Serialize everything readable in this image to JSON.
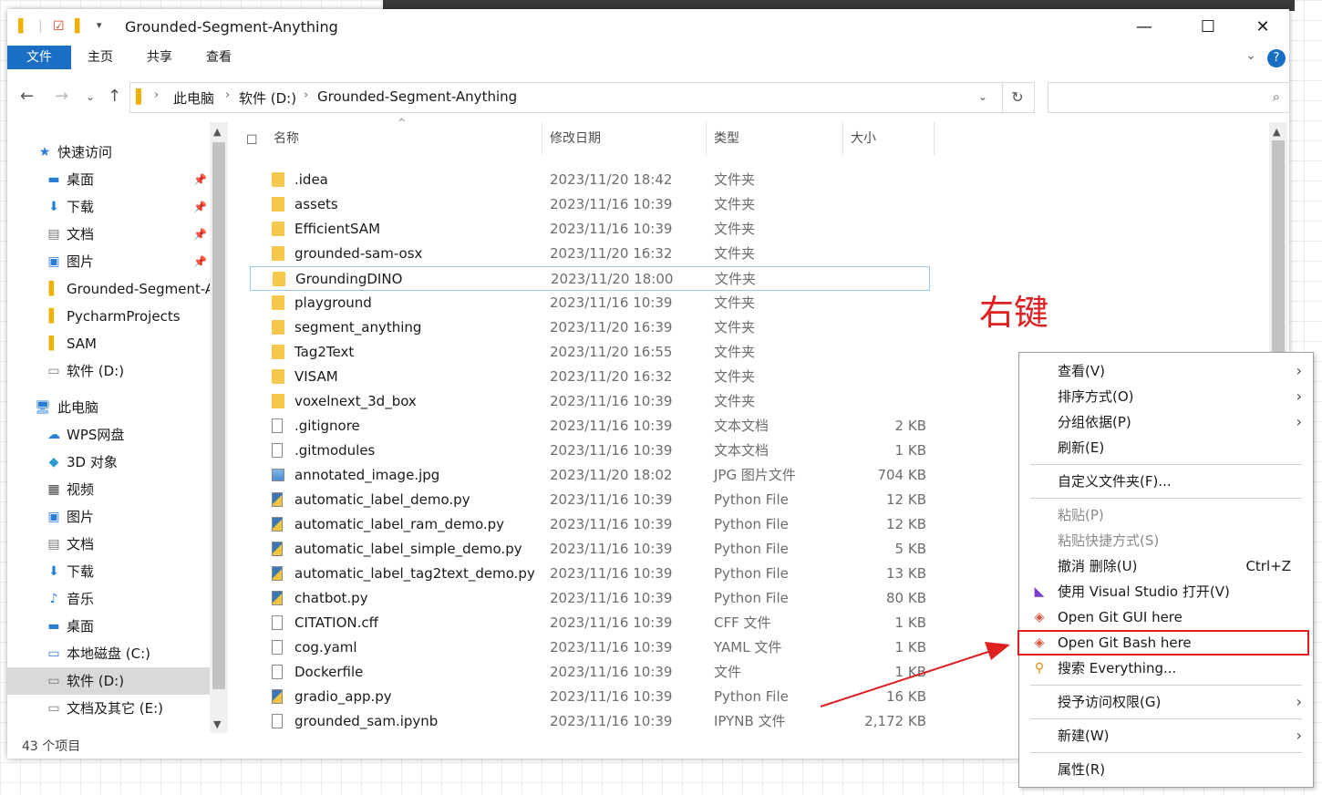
{
  "window": {
    "title": "Grounded-Segment-Anything",
    "controls": {
      "minimize": "—",
      "maximize": "☐",
      "close": "✕"
    }
  },
  "ribbon": {
    "tabs": [
      "文件",
      "主页",
      "共享",
      "查看"
    ],
    "help": "?"
  },
  "address": {
    "crumbs": [
      "此电脑",
      "软件 (D:)",
      "Grounded-Segment-Anything"
    ],
    "search_placeholder": ""
  },
  "nav": {
    "quick_access": "快速访问",
    "items": [
      {
        "label": "桌面",
        "icon": "desktop-icon",
        "pinned": true
      },
      {
        "label": "下载",
        "icon": "download-icon",
        "pinned": true
      },
      {
        "label": "文档",
        "icon": "document-icon",
        "pinned": true
      },
      {
        "label": "图片",
        "icon": "picture-icon",
        "pinned": true
      },
      {
        "label": "Grounded-Segment-Anything",
        "icon": "folder-icon",
        "pinned": false
      },
      {
        "label": "PycharmProjects",
        "icon": "folder-icon",
        "pinned": false
      },
      {
        "label": "SAM",
        "icon": "folder-icon",
        "pinned": false
      },
      {
        "label": "软件 (D:)",
        "icon": "drive-icon",
        "pinned": false
      }
    ],
    "this_pc": "此电脑",
    "pc_items": [
      {
        "label": "WPS网盘",
        "icon": "cloud-icon"
      },
      {
        "label": "3D 对象",
        "icon": "cube-icon"
      },
      {
        "label": "视频",
        "icon": "video-icon"
      },
      {
        "label": "图片",
        "icon": "picture-icon"
      },
      {
        "label": "文档",
        "icon": "document-icon"
      },
      {
        "label": "下载",
        "icon": "download-icon"
      },
      {
        "label": "音乐",
        "icon": "music-icon"
      },
      {
        "label": "桌面",
        "icon": "desktop-icon"
      },
      {
        "label": "本地磁盘 (C:)",
        "icon": "drive-icon"
      },
      {
        "label": "软件 (D:)",
        "icon": "drive-icon"
      },
      {
        "label": "文档及其它 (E:)",
        "icon": "drive-icon"
      }
    ],
    "selected": "软件 (D:)"
  },
  "list": {
    "columns": [
      "名称",
      "修改日期",
      "类型",
      "大小"
    ],
    "rows": [
      {
        "name": ".idea",
        "date": "2023/11/20 18:42",
        "type": "文件夹",
        "size": "",
        "kind": "folder"
      },
      {
        "name": "assets",
        "date": "2023/11/16 10:39",
        "type": "文件夹",
        "size": "",
        "kind": "folder"
      },
      {
        "name": "EfficientSAM",
        "date": "2023/11/16 10:39",
        "type": "文件夹",
        "size": "",
        "kind": "folder"
      },
      {
        "name": "grounded-sam-osx",
        "date": "2023/11/20 16:32",
        "type": "文件夹",
        "size": "",
        "kind": "folder"
      },
      {
        "name": "GroundingDINO",
        "date": "2023/11/20 18:00",
        "type": "文件夹",
        "size": "",
        "kind": "folder"
      },
      {
        "name": "playground",
        "date": "2023/11/16 10:39",
        "type": "文件夹",
        "size": "",
        "kind": "folder"
      },
      {
        "name": "segment_anything",
        "date": "2023/11/20 16:39",
        "type": "文件夹",
        "size": "",
        "kind": "folder"
      },
      {
        "name": "Tag2Text",
        "date": "2023/11/20 16:55",
        "type": "文件夹",
        "size": "",
        "kind": "folder"
      },
      {
        "name": "VISAM",
        "date": "2023/11/20 16:32",
        "type": "文件夹",
        "size": "",
        "kind": "folder"
      },
      {
        "name": "voxelnext_3d_box",
        "date": "2023/11/16 10:39",
        "type": "文件夹",
        "size": "",
        "kind": "folder"
      },
      {
        "name": ".gitignore",
        "date": "2023/11/16 10:39",
        "type": "文本文档",
        "size": "2 KB",
        "kind": "doc"
      },
      {
        "name": ".gitmodules",
        "date": "2023/11/16 10:39",
        "type": "文本文档",
        "size": "1 KB",
        "kind": "doc"
      },
      {
        "name": "annotated_image.jpg",
        "date": "2023/11/20 18:02",
        "type": "JPG 图片文件",
        "size": "704 KB",
        "kind": "jpg"
      },
      {
        "name": "automatic_label_demo.py",
        "date": "2023/11/16 10:39",
        "type": "Python File",
        "size": "12 KB",
        "kind": "py"
      },
      {
        "name": "automatic_label_ram_demo.py",
        "date": "2023/11/16 10:39",
        "type": "Python File",
        "size": "12 KB",
        "kind": "py"
      },
      {
        "name": "automatic_label_simple_demo.py",
        "date": "2023/11/16 10:39",
        "type": "Python File",
        "size": "5 KB",
        "kind": "py"
      },
      {
        "name": "automatic_label_tag2text_demo.py",
        "date": "2023/11/16 10:39",
        "type": "Python File",
        "size": "13 KB",
        "kind": "py"
      },
      {
        "name": "chatbot.py",
        "date": "2023/11/16 10:39",
        "type": "Python File",
        "size": "80 KB",
        "kind": "py"
      },
      {
        "name": "CITATION.cff",
        "date": "2023/11/16 10:39",
        "type": "CFF 文件",
        "size": "1 KB",
        "kind": "doc"
      },
      {
        "name": "cog.yaml",
        "date": "2023/11/16 10:39",
        "type": "YAML 文件",
        "size": "1 KB",
        "kind": "doc"
      },
      {
        "name": "Dockerfile",
        "date": "2023/11/16 10:39",
        "type": "文件",
        "size": "1 KB",
        "kind": "doc"
      },
      {
        "name": "gradio_app.py",
        "date": "2023/11/16 10:39",
        "type": "Python File",
        "size": "16 KB",
        "kind": "py"
      },
      {
        "name": "grounded_sam.ipynb",
        "date": "2023/11/16 10:39",
        "type": "IPYNB 文件",
        "size": "2,172 KB",
        "kind": "doc"
      }
    ],
    "focused_row": "GroundingDINO"
  },
  "status": {
    "count": "43 个项目"
  },
  "annotation": {
    "text": "右键",
    "color": "#e02020"
  },
  "context_menu": {
    "items": [
      {
        "label": "查看(V)",
        "submenu": true
      },
      {
        "label": "排序方式(O)",
        "submenu": true
      },
      {
        "label": "分组依据(P)",
        "submenu": true
      },
      {
        "label": "刷新(E)",
        "submenu": false
      },
      {
        "label": "自定义文件夹(F)...",
        "submenu": false
      },
      {
        "label": "粘贴(P)",
        "disabled": true
      },
      {
        "label": "粘贴快捷方式(S)",
        "disabled": true
      },
      {
        "label": "撤消 删除(U)",
        "shortcut": "Ctrl+Z"
      },
      {
        "label": "使用 Visual Studio 打开(V)",
        "icon": "visual-studio-icon"
      },
      {
        "label": "Open Git GUI here",
        "icon": "git-icon"
      },
      {
        "label": "Open Git Bash here",
        "icon": "git-icon"
      },
      {
        "label": "搜索 Everything...",
        "icon": "everything-search-icon"
      },
      {
        "label": "授予访问权限(G)",
        "submenu": true
      },
      {
        "label": "新建(W)",
        "submenu": true
      },
      {
        "label": "属性(R)",
        "submenu": false
      }
    ],
    "highlighted": "Open Git Bash here"
  }
}
